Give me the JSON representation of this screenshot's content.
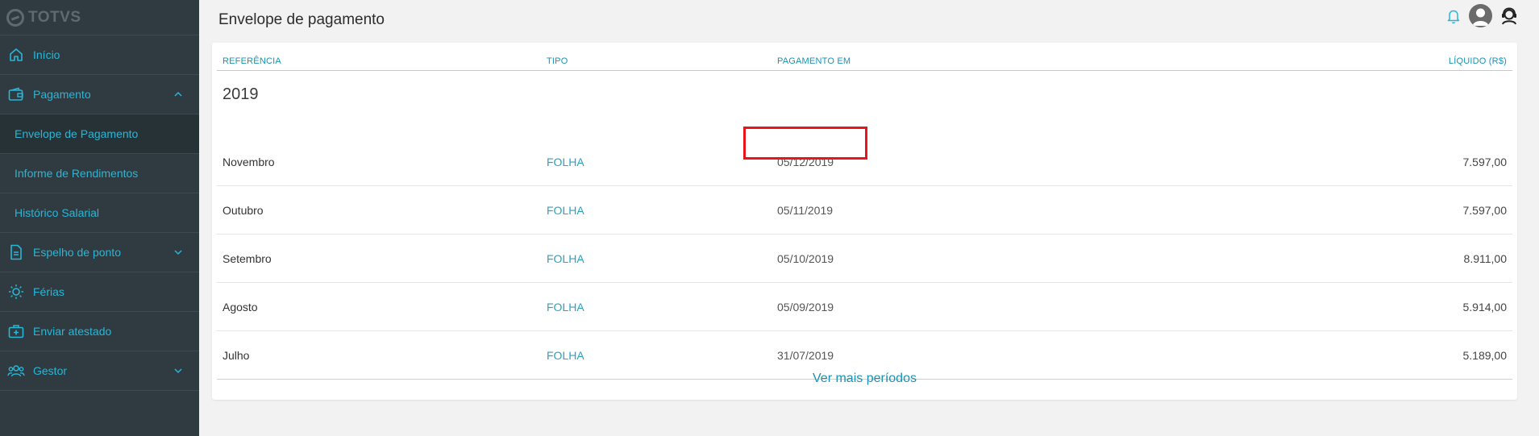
{
  "brand": {
    "name": "TOTVS"
  },
  "sidebar": {
    "items": [
      {
        "label": "Início",
        "icon": "home-icon"
      },
      {
        "label": "Pagamento",
        "icon": "wallet-icon",
        "expanded": true
      },
      {
        "label": "Envelope de Pagamento",
        "sub": true,
        "active": true
      },
      {
        "label": "Informe de Rendimentos",
        "sub": true
      },
      {
        "label": "Histórico Salarial",
        "sub": true
      },
      {
        "label": "Espelho de ponto",
        "icon": "document-icon",
        "expanded": false
      },
      {
        "label": "Férias",
        "icon": "sun-icon"
      },
      {
        "label": "Enviar atestado",
        "icon": "medical-kit-icon"
      },
      {
        "label": "Gestor",
        "icon": "team-icon",
        "expanded": false
      }
    ]
  },
  "header": {
    "title": "Envelope de pagamento"
  },
  "table": {
    "columns": {
      "ref": "REFERÊNCIA",
      "tipo": "TIPO",
      "pagamento": "PAGAMENTO EM",
      "liquido": "LÍQUIDO (R$)"
    },
    "year": "2019",
    "rows": [
      {
        "ref": "Novembro",
        "tipo": "FOLHA",
        "pagamento": "05/12/2019",
        "liquido": "7.597,00"
      },
      {
        "ref": "Outubro",
        "tipo": "FOLHA",
        "pagamento": "05/11/2019",
        "liquido": "7.597,00"
      },
      {
        "ref": "Setembro",
        "tipo": "FOLHA",
        "pagamento": "05/10/2019",
        "liquido": "8.911,00"
      },
      {
        "ref": "Agosto",
        "tipo": "FOLHA",
        "pagamento": "05/09/2019",
        "liquido": "5.914,00"
      },
      {
        "ref": "Julho",
        "tipo": "FOLHA",
        "pagamento": "31/07/2019",
        "liquido": "5.189,00"
      }
    ],
    "more_label": "Ver mais períodos"
  },
  "colors": {
    "sidebar_bg": "#2f3b41",
    "accent": "#29b6d6",
    "highlight": "#e8151b"
  }
}
